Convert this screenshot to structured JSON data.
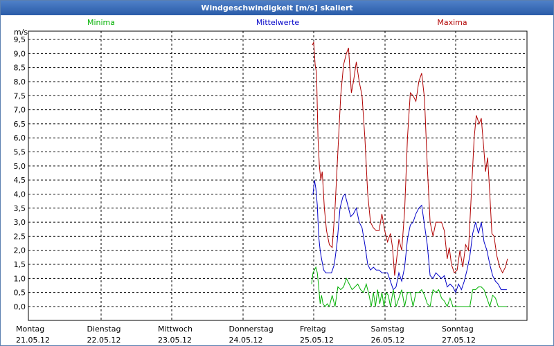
{
  "title": "Windgeschwindigkeit [m/s] skaliert",
  "legend": {
    "min": "Minima",
    "mean": "Mittelwerte",
    "max": "Maxima"
  },
  "colors": {
    "min": "#00b000",
    "mean": "#0000c8",
    "max": "#b00000",
    "title_bg": "#3a6cb8",
    "grid": "#000000"
  },
  "chart_data": {
    "type": "line",
    "y_unit": "m/s",
    "ylim": [
      0,
      9.5
    ],
    "yticks": [
      "9,5",
      "9,0",
      "8,5",
      "8,0",
      "7,5",
      "7,0",
      "6,5",
      "6,0",
      "5,5",
      "5,0",
      "4,5",
      "4,0",
      "3,5",
      "3,0",
      "2,5",
      "2,0",
      "1,5",
      "1,0",
      "0,5",
      "0,0"
    ],
    "days": [
      {
        "name": "Montag",
        "date": "21.05.12"
      },
      {
        "name": "Dienstag",
        "date": "22.05.12"
      },
      {
        "name": "Mittwoch",
        "date": "23.05.12"
      },
      {
        "name": "Donnerstag",
        "date": "24.05.12"
      },
      {
        "name": "Freitag",
        "date": "25.05.12"
      },
      {
        "name": "Samstag",
        "date": "26.05.12"
      },
      {
        "name": "Sonntag",
        "date": "27.05.12"
      }
    ],
    "x_range_days": [
      0,
      7
    ],
    "grid": true,
    "series": [
      {
        "name": "Maxima",
        "key": "max",
        "points": [
          [
            4.0,
            9.3
          ],
          [
            4.02,
            9.4
          ],
          [
            4.04,
            8.6
          ],
          [
            4.06,
            8.3
          ],
          [
            4.08,
            6.0
          ],
          [
            4.1,
            5.0
          ],
          [
            4.12,
            4.5
          ],
          [
            4.14,
            4.8
          ],
          [
            4.17,
            3.5
          ],
          [
            4.2,
            2.7
          ],
          [
            4.24,
            2.2
          ],
          [
            4.28,
            2.1
          ],
          [
            4.32,
            3.5
          ],
          [
            4.36,
            5.5
          ],
          [
            4.4,
            7.5
          ],
          [
            4.44,
            8.6
          ],
          [
            4.48,
            9.0
          ],
          [
            4.51,
            9.2
          ],
          [
            4.55,
            7.6
          ],
          [
            4.58,
            8.0
          ],
          [
            4.62,
            8.7
          ],
          [
            4.66,
            8.0
          ],
          [
            4.7,
            7.5
          ],
          [
            4.74,
            6.0
          ],
          [
            4.78,
            4.0
          ],
          [
            4.82,
            3.0
          ],
          [
            4.86,
            2.8
          ],
          [
            4.9,
            2.7
          ],
          [
            4.94,
            2.7
          ],
          [
            4.98,
            3.3
          ],
          [
            5.02,
            2.7
          ],
          [
            5.06,
            2.3
          ],
          [
            5.1,
            2.6
          ],
          [
            5.13,
            2.1
          ],
          [
            5.16,
            1.1
          ],
          [
            5.18,
            1.5
          ],
          [
            5.22,
            2.4
          ],
          [
            5.26,
            2.0
          ],
          [
            5.3,
            3.4
          ],
          [
            5.34,
            6.0
          ],
          [
            5.38,
            7.6
          ],
          [
            5.42,
            7.5
          ],
          [
            5.46,
            7.3
          ],
          [
            5.5,
            8.0
          ],
          [
            5.54,
            8.3
          ],
          [
            5.58,
            7.4
          ],
          [
            5.62,
            5.0
          ],
          [
            5.66,
            3.0
          ],
          [
            5.7,
            2.5
          ],
          [
            5.74,
            3.0
          ],
          [
            5.78,
            3.0
          ],
          [
            5.82,
            3.0
          ],
          [
            5.86,
            2.7
          ],
          [
            5.9,
            1.7
          ],
          [
            5.93,
            2.1
          ],
          [
            5.96,
            1.5
          ],
          [
            6.0,
            1.2
          ],
          [
            6.04,
            1.3
          ],
          [
            6.08,
            2.0
          ],
          [
            6.12,
            1.4
          ],
          [
            6.16,
            2.2
          ],
          [
            6.2,
            2.0
          ],
          [
            6.24,
            4.0
          ],
          [
            6.28,
            6.0
          ],
          [
            6.31,
            6.8
          ],
          [
            6.35,
            6.5
          ],
          [
            6.38,
            6.7
          ],
          [
            6.42,
            5.5
          ],
          [
            6.44,
            4.8
          ],
          [
            6.47,
            5.3
          ],
          [
            6.5,
            4.0
          ],
          [
            6.53,
            2.6
          ],
          [
            6.56,
            2.5
          ],
          [
            6.6,
            1.8
          ],
          [
            6.64,
            1.4
          ],
          [
            6.68,
            1.2
          ],
          [
            6.72,
            1.4
          ],
          [
            6.75,
            1.7
          ]
        ]
      },
      {
        "name": "Mittelwerte",
        "key": "mean",
        "points": [
          [
            3.99,
            4.0
          ],
          [
            4.01,
            4.0
          ],
          [
            4.03,
            4.5
          ],
          [
            4.05,
            4.2
          ],
          [
            4.07,
            3.6
          ],
          [
            4.09,
            2.5
          ],
          [
            4.11,
            2.0
          ],
          [
            4.13,
            1.7
          ],
          [
            4.16,
            1.3
          ],
          [
            4.19,
            1.2
          ],
          [
            4.23,
            1.2
          ],
          [
            4.27,
            1.2
          ],
          [
            4.31,
            1.5
          ],
          [
            4.35,
            2.3
          ],
          [
            4.39,
            3.5
          ],
          [
            4.43,
            3.9
          ],
          [
            4.46,
            4.0
          ],
          [
            4.5,
            3.6
          ],
          [
            4.54,
            3.2
          ],
          [
            4.58,
            3.3
          ],
          [
            4.62,
            3.5
          ],
          [
            4.66,
            3.0
          ],
          [
            4.7,
            2.8
          ],
          [
            4.74,
            2.2
          ],
          [
            4.78,
            1.5
          ],
          [
            4.82,
            1.3
          ],
          [
            4.86,
            1.4
          ],
          [
            4.9,
            1.3
          ],
          [
            4.94,
            1.3
          ],
          [
            4.98,
            1.2
          ],
          [
            5.02,
            1.2
          ],
          [
            5.06,
            1.2
          ],
          [
            5.1,
            0.9
          ],
          [
            5.14,
            0.6
          ],
          [
            5.18,
            0.7
          ],
          [
            5.22,
            1.2
          ],
          [
            5.26,
            0.9
          ],
          [
            5.3,
            1.4
          ],
          [
            5.34,
            2.4
          ],
          [
            5.38,
            2.9
          ],
          [
            5.42,
            3.0
          ],
          [
            5.46,
            3.3
          ],
          [
            5.5,
            3.5
          ],
          [
            5.54,
            3.6
          ],
          [
            5.58,
            2.9
          ],
          [
            5.62,
            2.2
          ],
          [
            5.66,
            1.1
          ],
          [
            5.7,
            1.0
          ],
          [
            5.74,
            1.2
          ],
          [
            5.78,
            1.1
          ],
          [
            5.82,
            1.0
          ],
          [
            5.86,
            1.1
          ],
          [
            5.9,
            0.7
          ],
          [
            5.94,
            0.8
          ],
          [
            5.98,
            0.7
          ],
          [
            6.02,
            0.5
          ],
          [
            6.06,
            0.8
          ],
          [
            6.1,
            0.6
          ],
          [
            6.14,
            0.9
          ],
          [
            6.18,
            1.3
          ],
          [
            6.22,
            1.8
          ],
          [
            6.26,
            2.6
          ],
          [
            6.3,
            3.0
          ],
          [
            6.34,
            2.6
          ],
          [
            6.38,
            3.0
          ],
          [
            6.42,
            2.3
          ],
          [
            6.46,
            2.0
          ],
          [
            6.5,
            1.5
          ],
          [
            6.54,
            1.1
          ],
          [
            6.58,
            0.9
          ],
          [
            6.62,
            0.8
          ],
          [
            6.66,
            0.6
          ],
          [
            6.7,
            0.6
          ],
          [
            6.74,
            0.6
          ]
        ]
      },
      {
        "name": "Minima",
        "key": "min",
        "points": [
          [
            3.99,
            0.8
          ],
          [
            4.01,
            1.2
          ],
          [
            4.03,
            1.3
          ],
          [
            4.05,
            1.4
          ],
          [
            4.07,
            1.2
          ],
          [
            4.09,
            0.7
          ],
          [
            4.11,
            0.1
          ],
          [
            4.13,
            0.4
          ],
          [
            4.15,
            0.1
          ],
          [
            4.18,
            0.0
          ],
          [
            4.21,
            0.1
          ],
          [
            4.24,
            0.0
          ],
          [
            4.28,
            0.4
          ],
          [
            4.32,
            0.0
          ],
          [
            4.36,
            0.7
          ],
          [
            4.4,
            0.6
          ],
          [
            4.44,
            0.7
          ],
          [
            4.48,
            1.0
          ],
          [
            4.52,
            0.8
          ],
          [
            4.56,
            0.6
          ],
          [
            4.6,
            0.7
          ],
          [
            4.64,
            0.8
          ],
          [
            4.68,
            0.6
          ],
          [
            4.72,
            0.5
          ],
          [
            4.76,
            0.8
          ],
          [
            4.8,
            0.4
          ],
          [
            4.83,
            0.0
          ],
          [
            4.86,
            0.5
          ],
          [
            4.89,
            0.0
          ],
          [
            4.92,
            0.6
          ],
          [
            4.95,
            0.1
          ],
          [
            4.98,
            0.5
          ],
          [
            5.01,
            0.0
          ],
          [
            5.04,
            0.5
          ],
          [
            5.07,
            0.4
          ],
          [
            5.1,
            0.0
          ],
          [
            5.14,
            0.6
          ],
          [
            5.18,
            0.0
          ],
          [
            5.22,
            0.3
          ],
          [
            5.26,
            0.6
          ],
          [
            5.3,
            0.0
          ],
          [
            5.34,
            0.5
          ],
          [
            5.38,
            0.5
          ],
          [
            5.42,
            0.0
          ],
          [
            5.46,
            0.5
          ],
          [
            5.5,
            0.5
          ],
          [
            5.54,
            0.6
          ],
          [
            5.58,
            0.4
          ],
          [
            5.62,
            0.1
          ],
          [
            5.66,
            0.0
          ],
          [
            5.7,
            0.6
          ],
          [
            5.74,
            0.5
          ],
          [
            5.78,
            0.6
          ],
          [
            5.82,
            0.3
          ],
          [
            5.86,
            0.2
          ],
          [
            5.9,
            0.0
          ],
          [
            5.94,
            0.3
          ],
          [
            5.98,
            0.0
          ],
          [
            6.02,
            0.0
          ],
          [
            6.08,
            0.0
          ],
          [
            6.14,
            0.0
          ],
          [
            6.18,
            0.0
          ],
          [
            6.22,
            0.0
          ],
          [
            6.26,
            0.6
          ],
          [
            6.3,
            0.6
          ],
          [
            6.34,
            0.7
          ],
          [
            6.38,
            0.7
          ],
          [
            6.42,
            0.6
          ],
          [
            6.46,
            0.3
          ],
          [
            6.5,
            0.0
          ],
          [
            6.54,
            0.4
          ],
          [
            6.58,
            0.3
          ],
          [
            6.62,
            0.0
          ],
          [
            6.66,
            0.0
          ],
          [
            6.7,
            0.0
          ],
          [
            6.74,
            0.0
          ]
        ]
      }
    ]
  }
}
